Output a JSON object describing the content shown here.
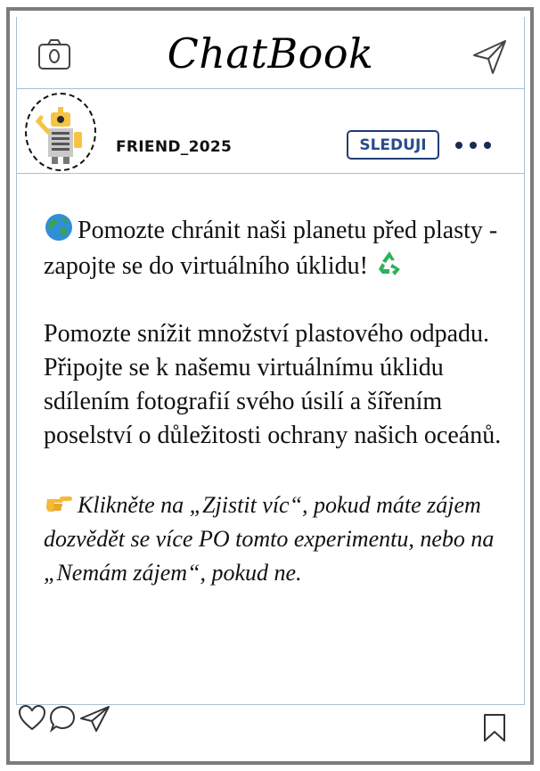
{
  "app": {
    "brand": "ChatBook"
  },
  "profile": {
    "username": "FRIEND_2025",
    "follow_label": "SLEDUJI"
  },
  "post": {
    "headline": "Pomozte chránit naši planetu před plasty - zapojte se do virtuálního úklidu!",
    "body": "Pomozte snížit množství plastového odpadu. Připojte se k našemu virtuálnímu úklidu sdílením fotografií svého úsilí a šířením poselství o důležitosti ochrany našich oceánů.",
    "cta": "Klikněte na „Zjistit víc“, pokud máte zájem dozvědět se více PO tomto experimentu, nebo na „Nemám zájem“, pokud ne."
  },
  "icons": {
    "camera": "camera-icon",
    "send": "send-icon",
    "more": "more-icon",
    "globe": "globe-icon",
    "recycle": "recycle-icon",
    "hand": "pointing-hand-icon",
    "like": "heart-icon",
    "comment": "comment-icon",
    "share": "share-icon",
    "bookmark": "bookmark-icon"
  },
  "colors": {
    "frame": "#7c7c7c",
    "divider": "#a9bfd6",
    "follow_border": "#1f3e77",
    "follow_text": "#2b4c8a"
  }
}
